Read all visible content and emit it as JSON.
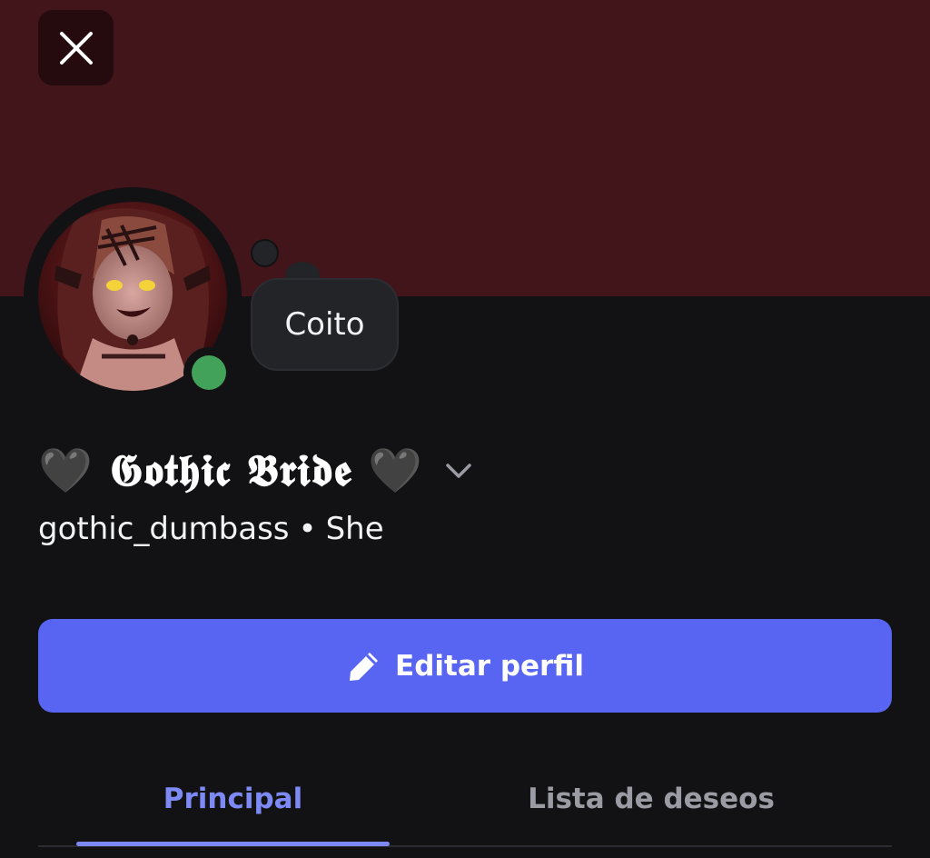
{
  "profile": {
    "display_name": "🖤 𝕲𝖔𝖙𝖍𝖎𝖈 𝕭𝖗𝖎𝖉𝖊 🖤",
    "username": "gothic_dumbass",
    "separator": "•",
    "pronouns": "She",
    "custom_status": "Coito",
    "online_status": "online"
  },
  "actions": {
    "edit_label": "Editar perfil"
  },
  "tabs": [
    {
      "label": "Principal",
      "active": true
    },
    {
      "label": "Lista de deseos",
      "active": false
    }
  ],
  "colors": {
    "banner": "#42151a",
    "background": "#121214",
    "accent": "#5865f2",
    "active_tab": "#7d89f5",
    "online": "#43a25a"
  },
  "icons": {
    "close": "close-icon",
    "chevron": "chevron-down-icon",
    "edit": "pencil-icon"
  }
}
